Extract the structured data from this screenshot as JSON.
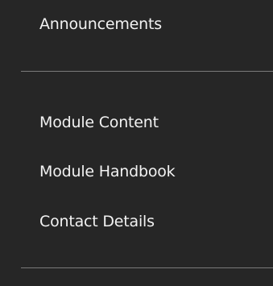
{
  "nav": {
    "items_top": [
      {
        "label": "Announcements"
      }
    ],
    "items_main": [
      {
        "label": "Module Content"
      },
      {
        "label": "Module Handbook"
      },
      {
        "label": "Contact Details"
      }
    ]
  },
  "colors": {
    "background": "#262626",
    "text": "#f2f2f2",
    "divider": "#7a7a7a"
  }
}
